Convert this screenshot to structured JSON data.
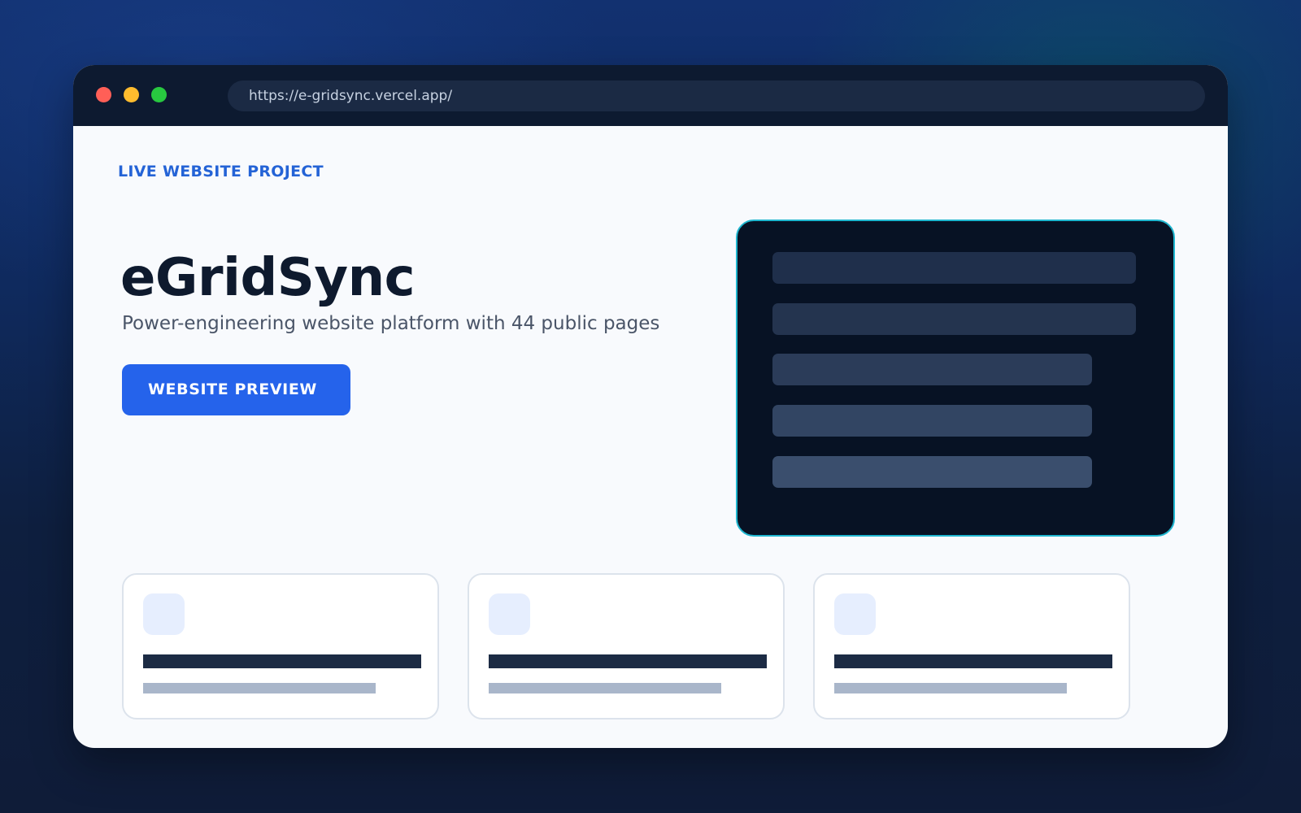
{
  "browser": {
    "url": "https://e-gridsync.vercel.app/",
    "traffic_lights": [
      {
        "name": "close",
        "color": "#ff5f57"
      },
      {
        "name": "minimize",
        "color": "#febc2e"
      },
      {
        "name": "maximize",
        "color": "#28c840"
      }
    ]
  },
  "hero": {
    "eyebrow": "LIVE WEBSITE PROJECT",
    "title": "eGridSync",
    "subtitle": "Power-engineering website platform with 44 public pages",
    "cta_label": "WEBSITE PREVIEW"
  },
  "colors": {
    "accent": "#2563eb",
    "preview_border": "#1fb6cf",
    "preview_bg": "#071224",
    "preview_bars": [
      "#1f2f4b",
      "#24344f",
      "#2b3c59",
      "#324563",
      "#3a4e6d"
    ]
  },
  "feature_cards": [
    {
      "icon": "feature-icon-placeholder"
    },
    {
      "icon": "feature-icon-placeholder"
    },
    {
      "icon": "feature-icon-placeholder"
    }
  ]
}
